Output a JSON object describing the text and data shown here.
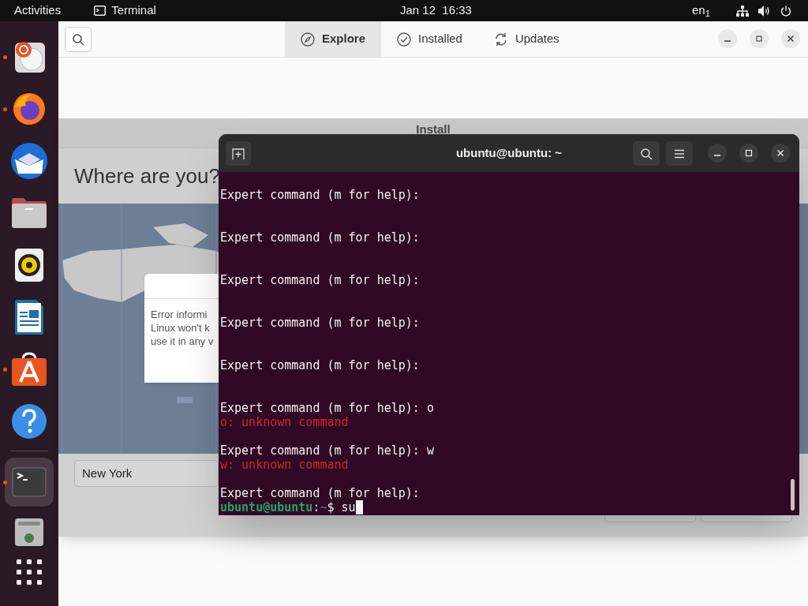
{
  "top_bar": {
    "activities": "Activities",
    "app_name": "Terminal",
    "clock": "Jan 12  16:33",
    "keyboard": "en$_{1}$"
  },
  "dock": {
    "items": [
      {
        "kind": "installer",
        "running": true,
        "active": false
      },
      {
        "kind": "browser",
        "running": true,
        "active": false
      },
      {
        "kind": "mail",
        "running": false,
        "active": false
      },
      {
        "kind": "files",
        "running": false,
        "active": false
      },
      {
        "kind": "music",
        "running": false,
        "active": false
      },
      {
        "kind": "writer",
        "running": false,
        "active": false
      },
      {
        "kind": "store",
        "running": true,
        "active": false
      },
      {
        "kind": "help",
        "running": false,
        "active": false
      },
      {
        "kind": "terminal",
        "running": true,
        "active": true
      },
      {
        "kind": "trash",
        "running": false,
        "active": false
      },
      {
        "kind": "apps",
        "running": false,
        "active": false
      }
    ]
  },
  "software": {
    "tabs": [
      {
        "label": "Explore",
        "selected": true
      },
      {
        "label": "Installed",
        "selected": false
      },
      {
        "label": "Updates",
        "selected": false
      }
    ]
  },
  "installer": {
    "title": "Install",
    "heading": "Where are you?",
    "error_lines": [
      "Error informi",
      "Linux won't k",
      "use it in any v"
    ],
    "city": "New York"
  },
  "terminal": {
    "title": "ubuntu@ubuntu: ~",
    "lines": [
      {
        "kind": "output",
        "text": "Expert command (m for help):"
      },
      {
        "kind": "output",
        "text": "Expert command (m for help):"
      },
      {
        "kind": "output",
        "text": "Expert command (m for help):"
      },
      {
        "kind": "output",
        "text": "Expert command (m for help):"
      },
      {
        "kind": "output",
        "text": "Expert command (m for help):"
      },
      {
        "kind": "output",
        "text": "Expert command (m for help): o"
      },
      {
        "kind": "error",
        "text": "o: unknown command"
      },
      {
        "kind": "output",
        "text": "Expert command (m for help): w"
      },
      {
        "kind": "error",
        "text": "w: unknown command"
      },
      {
        "kind": "output",
        "text": "Expert command (m for help):"
      }
    ],
    "prompt": {
      "user_host": "ubuntu@ubuntu",
      "separator": ":",
      "path": "~",
      "symbol": "$",
      "input": "su"
    }
  }
}
